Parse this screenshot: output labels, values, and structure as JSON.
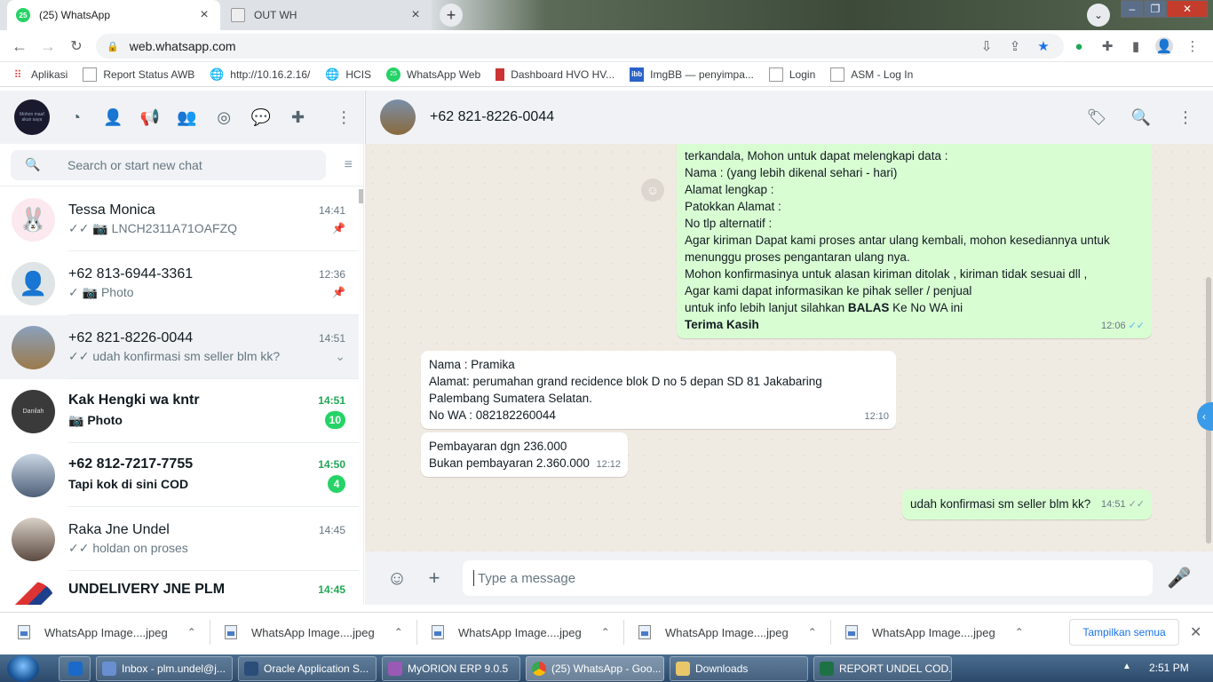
{
  "browser": {
    "tabs": [
      {
        "title": "(25) WhatsApp",
        "badge": "25"
      },
      {
        "title": "OUT WH"
      }
    ],
    "url": "web.whatsapp.com",
    "bookmarks": [
      "Aplikasi",
      "Report Status AWB",
      "http://10.16.2.16/",
      "HCIS",
      "WhatsApp Web",
      "Dashboard HVO HV...",
      "ImgBB — penyimpa...",
      "Login",
      "ASM - Log In"
    ]
  },
  "sidebar": {
    "my_avatar_text": "Mohon maaf akun saya",
    "search_placeholder": "Search or start new chat",
    "chats": [
      {
        "name": "Tessa Monica",
        "time": "14:41",
        "preview": "✓✓ 📷 LNCH2311A71OAFZQ",
        "pinned": true
      },
      {
        "name": "+62 813-6944-3361",
        "time": "12:36",
        "preview": "✓ 📷 Photo",
        "pinned": true
      },
      {
        "name": "+62 821-8226-0044",
        "time": "14:51",
        "preview": "✓✓ udah konfirmasi sm seller blm kk?"
      },
      {
        "name": "Kak Hengki wa kntr",
        "time": "14:51",
        "preview": "📷 Photo",
        "unread": "10",
        "avatar_text": "Danilah"
      },
      {
        "name": "+62 812-7217-7755",
        "time": "14:50",
        "preview": "Tapi kok di sini COD",
        "unread": "4"
      },
      {
        "name": "Raka Jne Undel",
        "time": "14:45",
        "preview": "✓✓ holdan on proses"
      },
      {
        "name": "UNDELIVERY JNE PLM",
        "time": "14:45"
      }
    ]
  },
  "conversation": {
    "contact_name": "+62 821-8226-0044",
    "messages": {
      "m1": {
        "lines": [
          "terkandala, Mohon untuk dapat melengkapi data :",
          "Nama : (yang lebih dikenal sehari - hari)",
          "Alamat  lengkap :",
          "Patokkan Alamat :",
          "No tlp alternatif :",
          "Agar kiriman Dapat kami proses antar ulang kembali, mohon kesediannya untuk",
          "menunggu proses pengantaran ulang nya.",
          "Mohon konfirmasinya untuk alasan kiriman ditolak , kiriman tidak sesuai dll ,",
          "Agar kami dapat informasikan ke pihak seller / penjual",
          "untuk info lebih lanjut silahkan ",
          "BALAS",
          " Ke No WA ini",
          "Terima Kasih"
        ],
        "time": "12:06"
      },
      "m2": {
        "lines": [
          "Nama : Pramika",
          "Alamat: perumahan grand recidence blok D no 5 depan SD 81 Jakabaring",
          "Palembang Sumatera Selatan.",
          "No WA : 082182260044"
        ],
        "time": "12:10"
      },
      "m3": {
        "lines": [
          "Pembayaran dgn 236.000",
          "Bukan pembayaran 2.360.000"
        ],
        "time": "12:12"
      },
      "m4": {
        "text": "udah konfirmasi sm seller blm kk?",
        "time": "14:51"
      }
    },
    "composer_placeholder": "Type a message"
  },
  "downloads": {
    "items": [
      "WhatsApp Image....jpeg",
      "WhatsApp Image....jpeg",
      "WhatsApp Image....jpeg",
      "WhatsApp Image....jpeg",
      "WhatsApp Image....jpeg"
    ],
    "show_all": "Tampilkan semua"
  },
  "taskbar": {
    "items": [
      "Inbox - plm.undel@j...",
      "Oracle Application S...",
      "MyORION ERP 9.0.5",
      "(25) WhatsApp - Goo...",
      "Downloads",
      "REPORT UNDEL COD..."
    ],
    "clock": "2:51 PM"
  },
  "colors": {
    "whatsapp_green": "#25d366",
    "outgoing_bubble": "#d9fdd3",
    "chat_bg": "#efeae2",
    "read_ticks": "#53bdeb"
  }
}
